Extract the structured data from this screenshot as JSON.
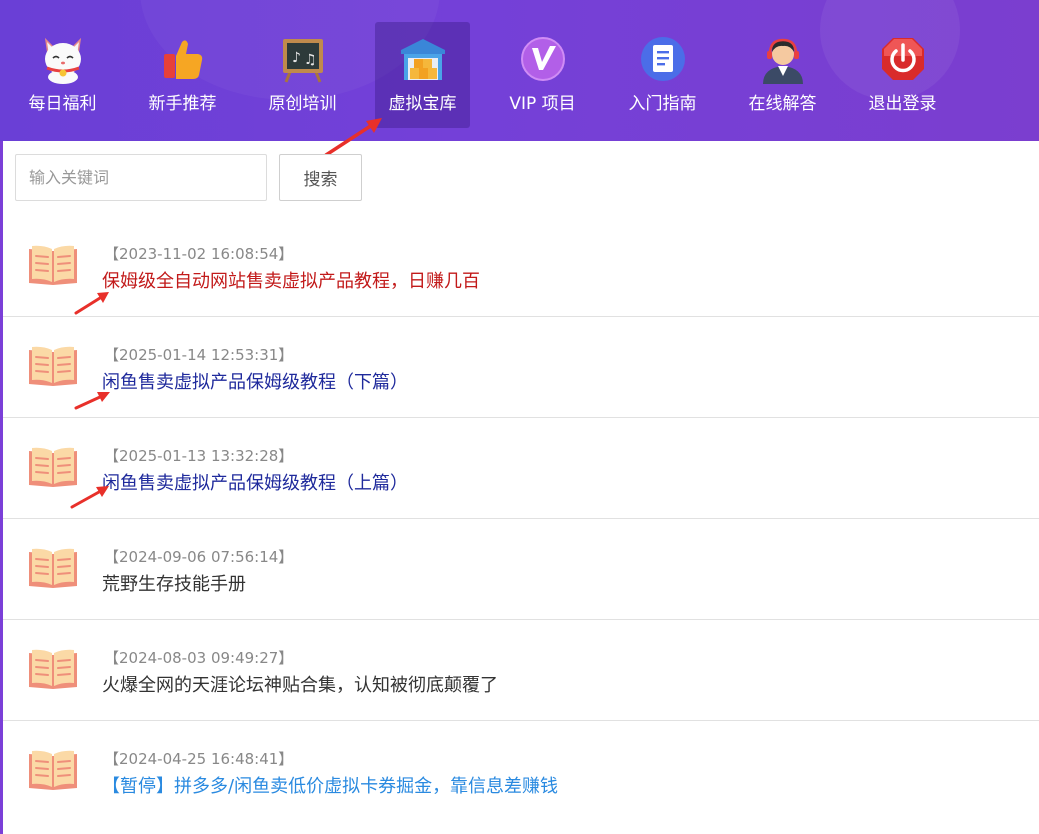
{
  "nav": {
    "items": [
      {
        "label": "每日福利",
        "icon": "lucky-cat-icon"
      },
      {
        "label": "新手推荐",
        "icon": "thumbs-up-icon"
      },
      {
        "label": "原创培训",
        "icon": "chalkboard-icon"
      },
      {
        "label": "虚拟宝库",
        "icon": "warehouse-icon",
        "active": true
      },
      {
        "label": "VIP 项目",
        "icon": "vip-icon"
      },
      {
        "label": "入门指南",
        "icon": "document-icon"
      },
      {
        "label": "在线解答",
        "icon": "support-agent-icon"
      },
      {
        "label": "退出登录",
        "icon": "power-icon"
      }
    ]
  },
  "search": {
    "placeholder": "输入关键词",
    "value": "",
    "button_label": "搜索"
  },
  "articles": [
    {
      "date": "【2023-11-02 16:08:54】",
      "title": "保姆级全自动网站售卖虚拟产品教程，日赚几百",
      "title_color": "#c21a1a"
    },
    {
      "date": "【2025-01-14 12:53:31】",
      "title": "闲鱼售卖虚拟产品保姆级教程（下篇）",
      "title_color": "#1f2a9c"
    },
    {
      "date": "【2025-01-13 13:32:28】",
      "title": "闲鱼售卖虚拟产品保姆级教程（上篇）",
      "title_color": "#1f2a9c"
    },
    {
      "date": "【2024-09-06 07:56:14】",
      "title": "荒野生存技能手册",
      "title_color": "#333333"
    },
    {
      "date": "【2024-08-03 09:49:27】",
      "title": "火爆全网的天涯论坛神贴合集，认知被彻底颠覆了",
      "title_color": "#333333"
    },
    {
      "date": "【2024-04-25 16:48:41】",
      "title": "【暂停】拼多多/闲鱼卖低价虚拟卡券掘金，靠信息差赚钱",
      "title_color": "#2a8ae0"
    }
  ],
  "colors": {
    "nav_bg": "#7440d8",
    "annotation_arrow": "#e8302a"
  }
}
